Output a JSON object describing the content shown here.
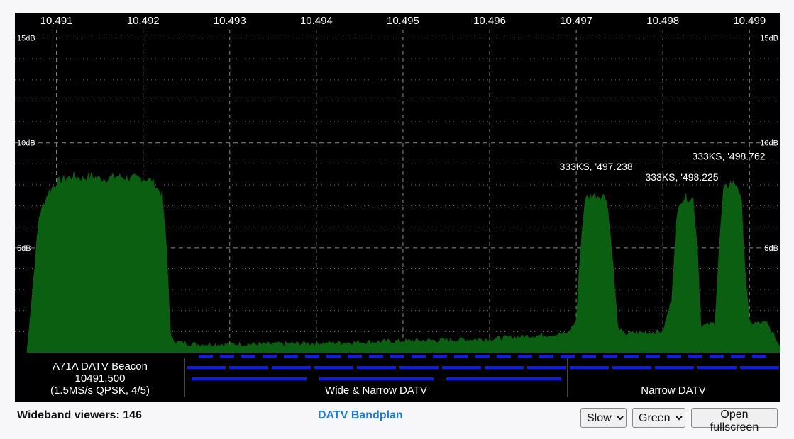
{
  "chart_data": {
    "type": "area",
    "title": "",
    "x_tick_labels": [
      "10.491",
      "10.492",
      "10.493",
      "10.494",
      "10.495",
      "10.496",
      "10.497",
      "10.498",
      "10.499"
    ],
    "xlim_mhz_offset": [
      10.49052,
      10.49935
    ],
    "y_tick_labels": [
      "15dB",
      "10dB",
      "5dB"
    ],
    "ylim_db": [
      0,
      16.2
    ],
    "grid": true,
    "series": [
      {
        "x": [
          10.49066,
          10.4908,
          10.4909,
          10.491,
          10.4911,
          10.4912,
          10.4913,
          10.4914,
          10.4915,
          10.4916,
          10.4917,
          10.49186,
          10.492,
          10.4921,
          10.49222,
          10.49227,
          10.49232,
          10.4924,
          10.4926,
          10.493,
          10.4935,
          10.494,
          10.4945,
          10.495,
          10.4955,
          10.496,
          10.4965,
          10.4969,
          10.497,
          10.49705,
          10.4971,
          10.49718,
          10.49728,
          10.49735,
          10.49741,
          10.49748,
          10.49755,
          10.498,
          10.4981,
          10.49815,
          10.4982,
          10.49828,
          10.49835,
          10.4984,
          10.49844,
          10.4985,
          10.4986,
          10.49865,
          10.4987,
          10.49878,
          10.49886,
          10.49891,
          10.49895,
          10.499,
          10.4992,
          10.49935
        ],
        "y": [
          0.1,
          6.5,
          7.6,
          8.1,
          8.3,
          8.4,
          8.3,
          8.4,
          8.3,
          8.3,
          8.4,
          8.3,
          8.3,
          8.2,
          7.5,
          5.0,
          0.7,
          0.5,
          0.4,
          0.4,
          0.4,
          0.45,
          0.5,
          0.55,
          0.6,
          0.65,
          0.8,
          0.9,
          1.5,
          5.0,
          7.3,
          7.5,
          7.5,
          7.4,
          5.0,
          1.2,
          0.9,
          1.0,
          2.5,
          6.0,
          7.3,
          7.4,
          7.3,
          5.0,
          1.3,
          1.3,
          1.4,
          5.0,
          7.7,
          8.1,
          8.0,
          7.0,
          4.0,
          1.4,
          1.4,
          0.3
        ]
      }
    ],
    "annotations": [
      {
        "text": "333KS, '497.238",
        "x": 10.49723,
        "y": 8.7
      },
      {
        "text": "333KS, '498.225",
        "x": 10.49822,
        "y": 8.2
      },
      {
        "text": "333KS, '498.762",
        "x": 10.49876,
        "y": 9.2
      }
    ]
  },
  "bandplan": {
    "beacon": {
      "line1": "A71A DATV Beacon",
      "line2": "10491.500",
      "line3": "(1.5MS/s QPSK, 4/5)"
    },
    "wide_narrow": "Wide & Narrow DATV",
    "narrow": "Narrow DATV"
  },
  "footer": {
    "viewers": "Wideband viewers: 146",
    "bandplan_link": "DATV Bandplan",
    "speed": {
      "selected": "Slow",
      "options": [
        "Slow"
      ]
    },
    "color": {
      "selected": "Green",
      "options": [
        "Green"
      ]
    },
    "fullscreen_label": "Open fullscreen"
  },
  "colors": {
    "background": "#000000",
    "signal_fill": "#0a6010",
    "grid": "#8a8a8a",
    "channel_bar": "#0c1cf0",
    "text": "#ffffff",
    "link": "#1e7ad8"
  }
}
